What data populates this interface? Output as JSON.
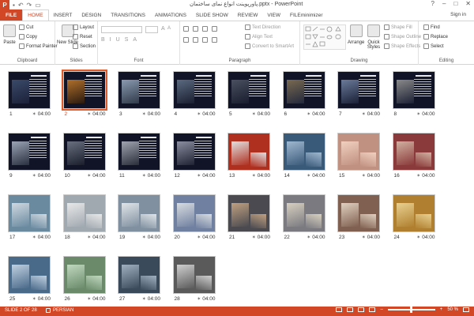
{
  "app": {
    "logo": "P",
    "title": "پاورپوینت انواع نمای ساختمان.pptx - PowerPoint",
    "window_controls": [
      "?",
      "–",
      "□",
      "✕"
    ],
    "sign_in": "Sign in"
  },
  "tabs": [
    "FILE",
    "HOME",
    "INSERT",
    "DESIGN",
    "TRANSITIONS",
    "ANIMATIONS",
    "SLIDE SHOW",
    "REVIEW",
    "VIEW",
    "FILEminimizer"
  ],
  "ribbon": {
    "clipboard": {
      "label": "Clipboard",
      "paste": "Paste",
      "cut": "Cut",
      "copy": "Copy",
      "format_painter": "Format Painter"
    },
    "slides": {
      "label": "Slides",
      "new_slide": "New Slide",
      "layout": "Layout",
      "reset": "Reset",
      "section": "Section"
    },
    "font": {
      "label": "Font"
    },
    "paragraph": {
      "label": "Paragraph",
      "text_direction": "Text Direction",
      "align_text": "Align Text",
      "convert_smartart": "Convert to SmartArt"
    },
    "drawing": {
      "label": "Drawing",
      "arrange": "Arrange",
      "quick_styles": "Quick Styles",
      "shape_fill": "Shape Fill",
      "shape_outline": "Shape Outline",
      "shape_effects": "Shape Effects"
    },
    "editing": {
      "label": "Editing",
      "find": "Find",
      "replace": "Replace",
      "select": "Select"
    }
  },
  "slides": [
    {
      "n": "1",
      "time": "04:00"
    },
    {
      "n": "2",
      "time": "04:00"
    },
    {
      "n": "3",
      "time": "04:00"
    },
    {
      "n": "4",
      "time": "04:00"
    },
    {
      "n": "5",
      "time": "04:00"
    },
    {
      "n": "6",
      "time": "04:00"
    },
    {
      "n": "7",
      "time": "04:00"
    },
    {
      "n": "8",
      "time": "04:00"
    },
    {
      "n": "9",
      "time": "04:00"
    },
    {
      "n": "10",
      "time": "04:00"
    },
    {
      "n": "11",
      "time": "04:00"
    },
    {
      "n": "12",
      "time": "04:00"
    },
    {
      "n": "13",
      "time": "04:00"
    },
    {
      "n": "14",
      "time": "04:00"
    },
    {
      "n": "15",
      "time": "04:00"
    },
    {
      "n": "16",
      "time": "04:00"
    },
    {
      "n": "17",
      "time": "04:00"
    },
    {
      "n": "18",
      "time": "04:00"
    },
    {
      "n": "19",
      "time": "04:00"
    },
    {
      "n": "20",
      "time": "04:00"
    },
    {
      "n": "21",
      "time": "04:00"
    },
    {
      "n": "22",
      "time": "04:00"
    },
    {
      "n": "23",
      "time": "04:00"
    },
    {
      "n": "24",
      "time": "04:00"
    },
    {
      "n": "25",
      "time": "04:00"
    },
    {
      "n": "26",
      "time": "04:00"
    },
    {
      "n": "27",
      "time": "04:00"
    },
    {
      "n": "28",
      "time": "04:00"
    }
  ],
  "selected_slide": 2,
  "status": {
    "slide_info": "SLIDE 2 OF 28",
    "language": "PERSIAN",
    "zoom": "50 %"
  },
  "colors": {
    "accent": "#d24726",
    "thumb_bg": "#101426"
  }
}
